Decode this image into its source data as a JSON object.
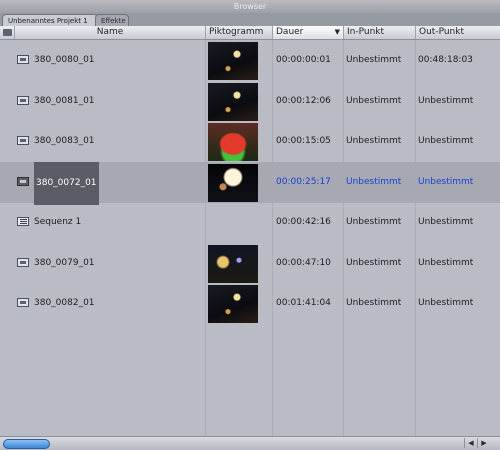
{
  "window": {
    "title": "Browser"
  },
  "tabs": [
    {
      "label": "Unbenanntes Projekt 1",
      "active": true
    },
    {
      "label": "Effekte",
      "active": false
    }
  ],
  "columns": {
    "name": "Name",
    "thumbnail": "Piktogramm",
    "duration": "Dauer",
    "in_point": "In-Punkt",
    "out_point": "Out-Punkt",
    "sorted_column": "duration",
    "sort_arrow": "▼"
  },
  "rows": [
    {
      "name": "380_0080_01",
      "type": "clip",
      "thumb": "a",
      "duration": "00:00:00:01",
      "in_point": "Unbestimmt",
      "out_point": "00:48:18:03",
      "selected": false
    },
    {
      "name": "380_0081_01",
      "type": "clip",
      "thumb": "a",
      "duration": "00:00:12:06",
      "in_point": "Unbestimmt",
      "out_point": "Unbestimmt",
      "selected": false
    },
    {
      "name": "380_0083_01",
      "type": "clip",
      "thumb": "b",
      "duration": "00:00:15:05",
      "in_point": "Unbestimmt",
      "out_point": "Unbestimmt",
      "selected": false
    },
    {
      "name": "380_0072_01",
      "type": "clip",
      "thumb": "c",
      "duration": "00:00:25:17",
      "in_point": "Unbestimmt",
      "out_point": "Unbestimmt",
      "selected": true
    },
    {
      "name": "Sequenz 1",
      "type": "sequence",
      "thumb": "",
      "duration": "00:00:42:16",
      "in_point": "Unbestimmt",
      "out_point": "Unbestimmt",
      "selected": false
    },
    {
      "name": "380_0079_01",
      "type": "clip",
      "thumb": "d",
      "duration": "00:00:47:10",
      "in_point": "Unbestimmt",
      "out_point": "Unbestimmt",
      "selected": false
    },
    {
      "name": "380_0082_01",
      "type": "clip",
      "thumb": "a",
      "duration": "00:01:41:04",
      "in_point": "Unbestimmt",
      "out_point": "Unbestimmt",
      "selected": false
    }
  ],
  "scrollbar": {
    "left_arrow": "◀",
    "right_arrow": "▶"
  },
  "colors": {
    "selection_text": "#1a3dd6",
    "scroll_thumb": "#3f86d6"
  }
}
